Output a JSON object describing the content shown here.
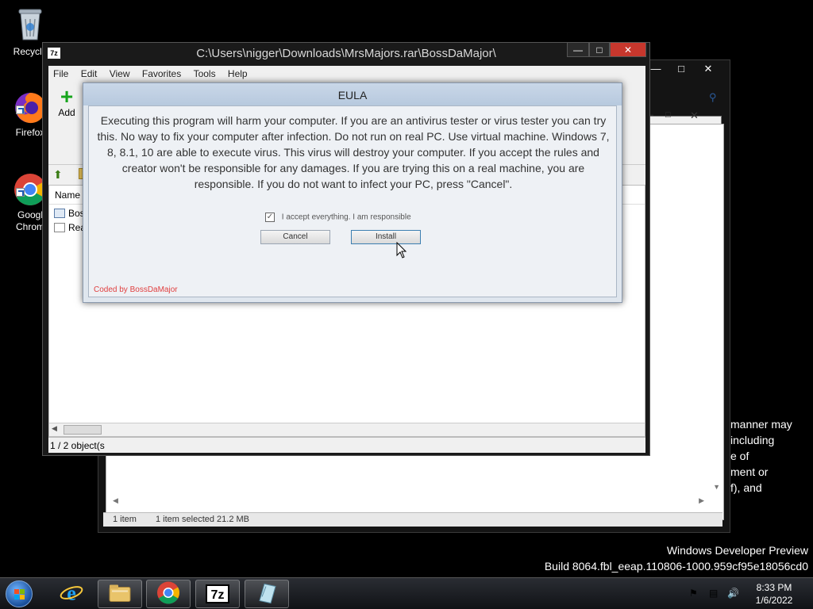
{
  "desktop": {
    "icons": [
      {
        "label": "Recycle",
        "icon": "recycle-bin-icon"
      },
      {
        "label": "Firefox",
        "icon": "firefox-icon"
      },
      {
        "label": "Google Chrome",
        "label_line1": "Googl",
        "label_line2": "Chrom",
        "icon": "chrome-icon"
      }
    ]
  },
  "explorer": {
    "status_count": "1 item",
    "status_selected": "1 item selected  21.2 MB"
  },
  "zip_window": {
    "app_badge": "7z",
    "title": "C:\\Users\\nigger\\Downloads\\MrsMajors.rar\\BossDaMajor\\",
    "menu": [
      "File",
      "Edit",
      "View",
      "Favorites",
      "Tools",
      "Help"
    ],
    "add_label": "Add",
    "column_name": "Name",
    "files": [
      "Boss",
      "Rea"
    ],
    "status": "1 / 2 object(s"
  },
  "eula": {
    "title": "EULA",
    "body": "Executing this program will harm your computer. If you are an antivirus tester or virus tester you can try this. No way to fix your computer after infection. Do not run on real PC. Use virtual machine. Windows 7, 8, 8.1, 10 are able to execute virus. This virus will destroy your computer. If you accept the rules and creator won't be responsible for any damages. If you are trying this on a real machine, you are responsible. If you do not want to infect your PC, press \"Cancel\".",
    "checkbox_label": "I accept everything. I am responsible",
    "cancel_label": "Cancel",
    "install_label": "Install",
    "credit": "Coded by BossDaMajor"
  },
  "license_fragment": [
    "manner may",
    "including",
    "e of",
    "ment or",
    "f), and"
  ],
  "watermark": {
    "line1": "Windows Developer Preview",
    "line2": "Build 8064.fbl_eeap.110806-1000.959cf95e18056cd0"
  },
  "taskbar": {
    "items": [
      {
        "name": "internet-explorer",
        "icon": "ie-icon"
      },
      {
        "name": "file-explorer",
        "icon": "folder-icon"
      },
      {
        "name": "chrome",
        "icon": "chrome-icon"
      },
      {
        "name": "7zip",
        "icon": "7zip-icon",
        "label": "7z"
      },
      {
        "name": "eula-app",
        "icon": "app-icon"
      }
    ],
    "time": "8:33 PM",
    "date": "1/6/2022"
  },
  "colors": {
    "accent_blue": "#1e5db7",
    "add_green": "#17a51c",
    "credit_red": "#e04040"
  }
}
